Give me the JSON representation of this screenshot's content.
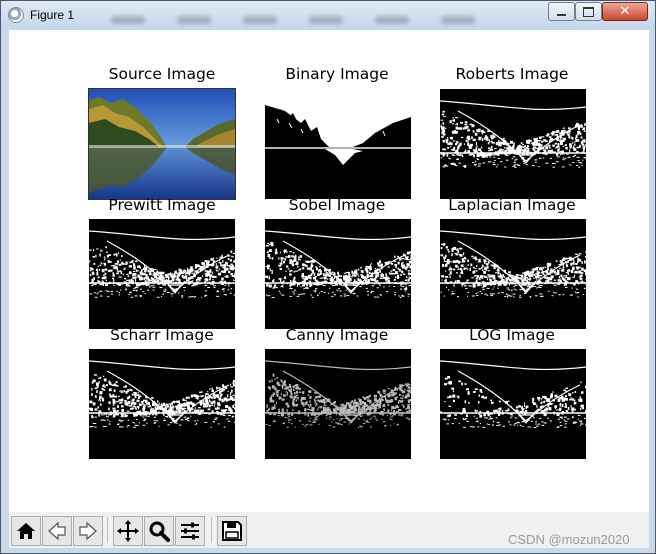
{
  "window": {
    "title": "Figure 1",
    "controls": {
      "minimize": "minimize",
      "maximize": "maximize",
      "close": "✕"
    }
  },
  "figure": {
    "panels": [
      {
        "title": "Source Image",
        "kind": "photo"
      },
      {
        "title": "Binary Image",
        "kind": "binary"
      },
      {
        "title": "Roberts Image",
        "kind": "edge"
      },
      {
        "title": "Prewitt Image",
        "kind": "edge"
      },
      {
        "title": "Sobel Image",
        "kind": "edge"
      },
      {
        "title": "Laplacian Image",
        "kind": "edge"
      },
      {
        "title": "Scharr Image",
        "kind": "edge"
      },
      {
        "title": "Canny Image",
        "kind": "edge"
      },
      {
        "title": "LOG Image",
        "kind": "edge"
      }
    ]
  },
  "toolbar": {
    "buttons": [
      "home-icon",
      "back-icon",
      "forward-icon",
      "pan-icon",
      "zoom-icon",
      "configure-subplots-icon",
      "save-icon"
    ]
  },
  "watermark": "CSDN @mozun2020"
}
